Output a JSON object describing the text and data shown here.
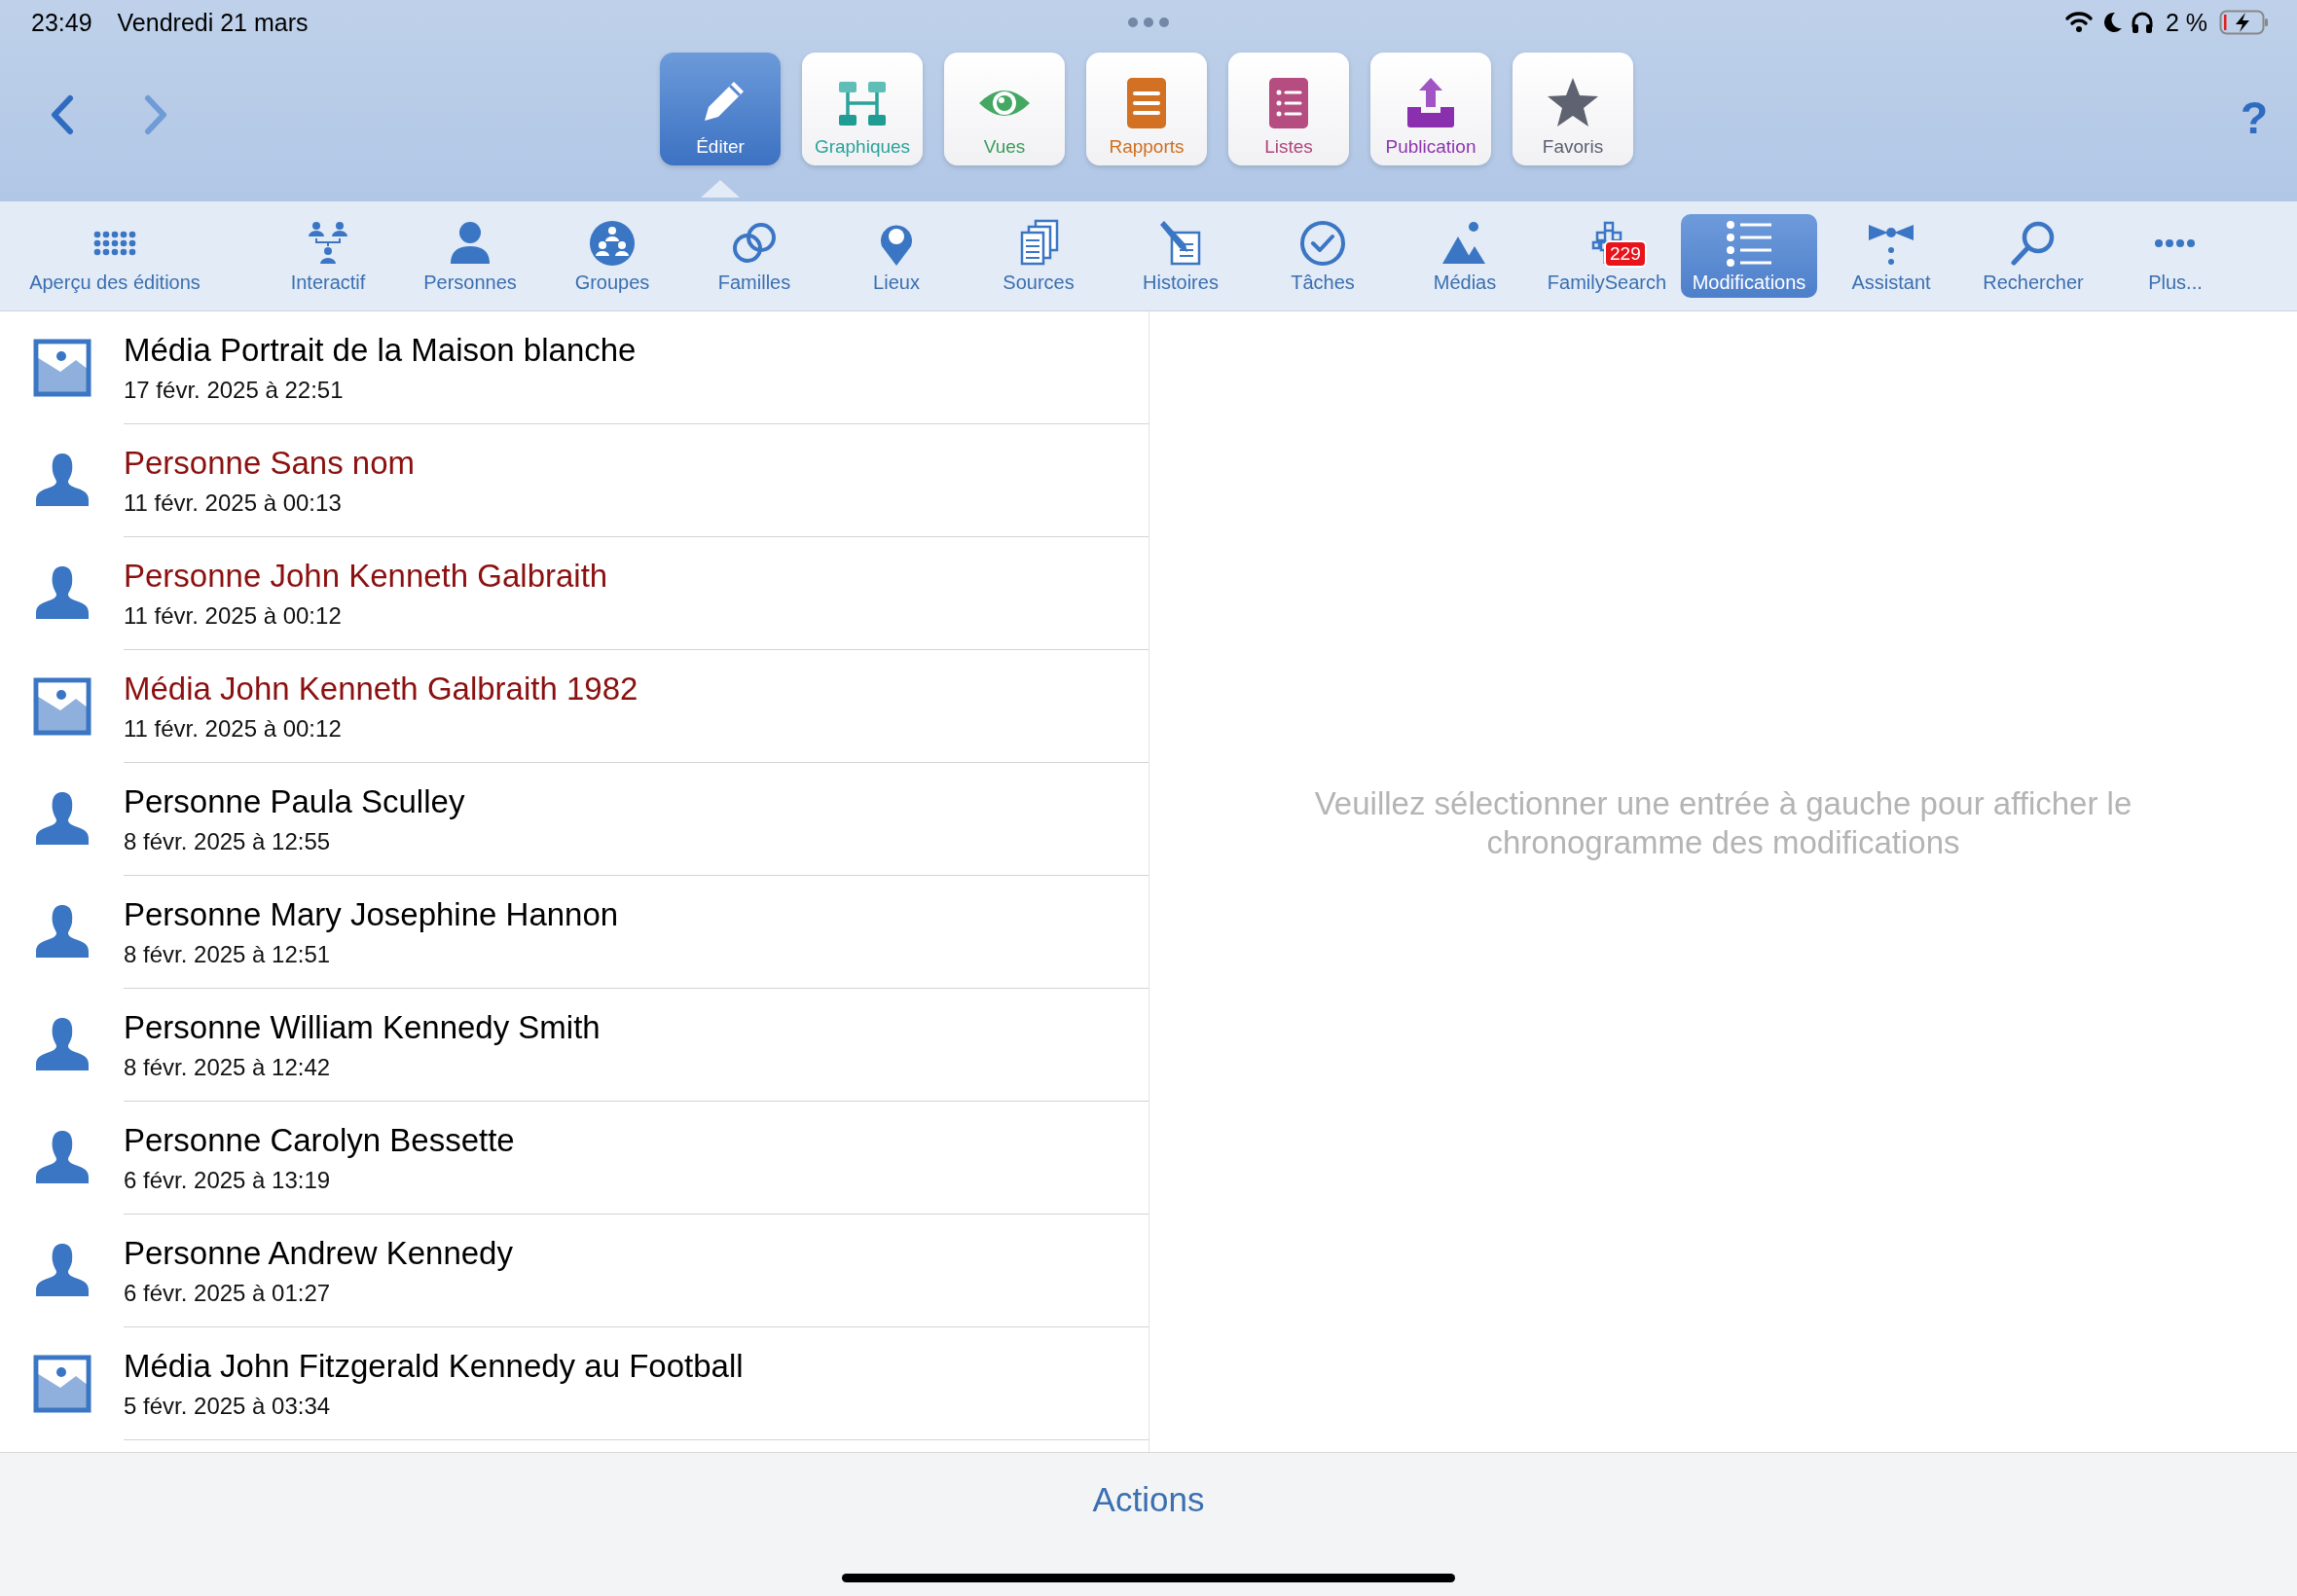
{
  "status_bar": {
    "time": "23:49",
    "date": "Vendredi 21 mars",
    "battery": "2 %"
  },
  "app_tiles": [
    {
      "kind": "edit",
      "label": "Éditer",
      "selected": true,
      "color": "#ffffff"
    },
    {
      "kind": "charts",
      "label": "Graphiques",
      "selected": false,
      "color": "#2aa39b"
    },
    {
      "kind": "views",
      "label": "Vues",
      "selected": false,
      "color": "#3a9d5a"
    },
    {
      "kind": "reports",
      "label": "Rapports",
      "selected": false,
      "color": "#cf6f1e"
    },
    {
      "kind": "lists",
      "label": "Listes",
      "selected": false,
      "color": "#b0467a"
    },
    {
      "kind": "publish",
      "label": "Publication",
      "selected": false,
      "color": "#8e35b0"
    },
    {
      "kind": "favorites",
      "label": "Favoris",
      "selected": false,
      "color": "#5c5f70"
    }
  ],
  "help": "?",
  "toolbar": [
    {
      "kind": "overview",
      "label": "Aperçu des éditions",
      "selected": false
    },
    {
      "kind": "interactive",
      "label": "Interactif",
      "selected": false
    },
    {
      "kind": "persons",
      "label": "Personnes",
      "selected": false
    },
    {
      "kind": "groups",
      "label": "Groupes",
      "selected": false
    },
    {
      "kind": "families",
      "label": "Familles",
      "selected": false
    },
    {
      "kind": "places",
      "label": "Lieux",
      "selected": false
    },
    {
      "kind": "sources",
      "label": "Sources",
      "selected": false
    },
    {
      "kind": "stories",
      "label": "Histoires",
      "selected": false
    },
    {
      "kind": "tasks",
      "label": "Tâches",
      "selected": false
    },
    {
      "kind": "media",
      "label": "Médias",
      "selected": false
    },
    {
      "kind": "familysearch",
      "label": "FamilySearch",
      "selected": false,
      "badge": "229"
    },
    {
      "kind": "changes",
      "label": "Modifications",
      "selected": true
    },
    {
      "kind": "assistant",
      "label": "Assistant",
      "selected": false
    },
    {
      "kind": "search",
      "label": "Rechercher",
      "selected": false
    },
    {
      "kind": "more",
      "label": "Plus...",
      "selected": false
    }
  ],
  "changes": [
    {
      "kind": "media",
      "title": "Média Portrait de la Maison blanche",
      "date": "17 févr. 2025 à 22:51",
      "color": "#000000"
    },
    {
      "kind": "person",
      "title": "Personne Sans nom",
      "date": "11 févr. 2025 à 00:13",
      "color": "#8b1010"
    },
    {
      "kind": "person",
      "title": "Personne John Kenneth Galbraith",
      "date": "11 févr. 2025 à 00:12",
      "color": "#8b1010"
    },
    {
      "kind": "media",
      "title": "Média John Kenneth Galbraith 1982",
      "date": "11 févr. 2025 à 00:12",
      "color": "#8b1010"
    },
    {
      "kind": "person",
      "title": "Personne Paula Sculley",
      "date": "8 févr. 2025 à 12:55",
      "color": "#000000"
    },
    {
      "kind": "person",
      "title": "Personne Mary Josephine Hannon",
      "date": "8 févr. 2025 à 12:51",
      "color": "#000000"
    },
    {
      "kind": "person",
      "title": "Personne William Kennedy Smith",
      "date": "8 févr. 2025 à 12:42",
      "color": "#000000"
    },
    {
      "kind": "person",
      "title": "Personne Carolyn Bessette",
      "date": "6 févr. 2025 à 13:19",
      "color": "#000000"
    },
    {
      "kind": "person",
      "title": "Personne Andrew Kennedy",
      "date": "6 févr. 2025 à 01:27",
      "color": "#000000"
    },
    {
      "kind": "media",
      "title": "Média John Fitzgerald Kennedy au Football",
      "date": "5 févr. 2025 à 03:34",
      "color": "#000000"
    }
  ],
  "detail_placeholder": "Veuillez sélectionner une entrée à gauche pour afficher le chronogramme des modifications",
  "actions_button": "Actions"
}
